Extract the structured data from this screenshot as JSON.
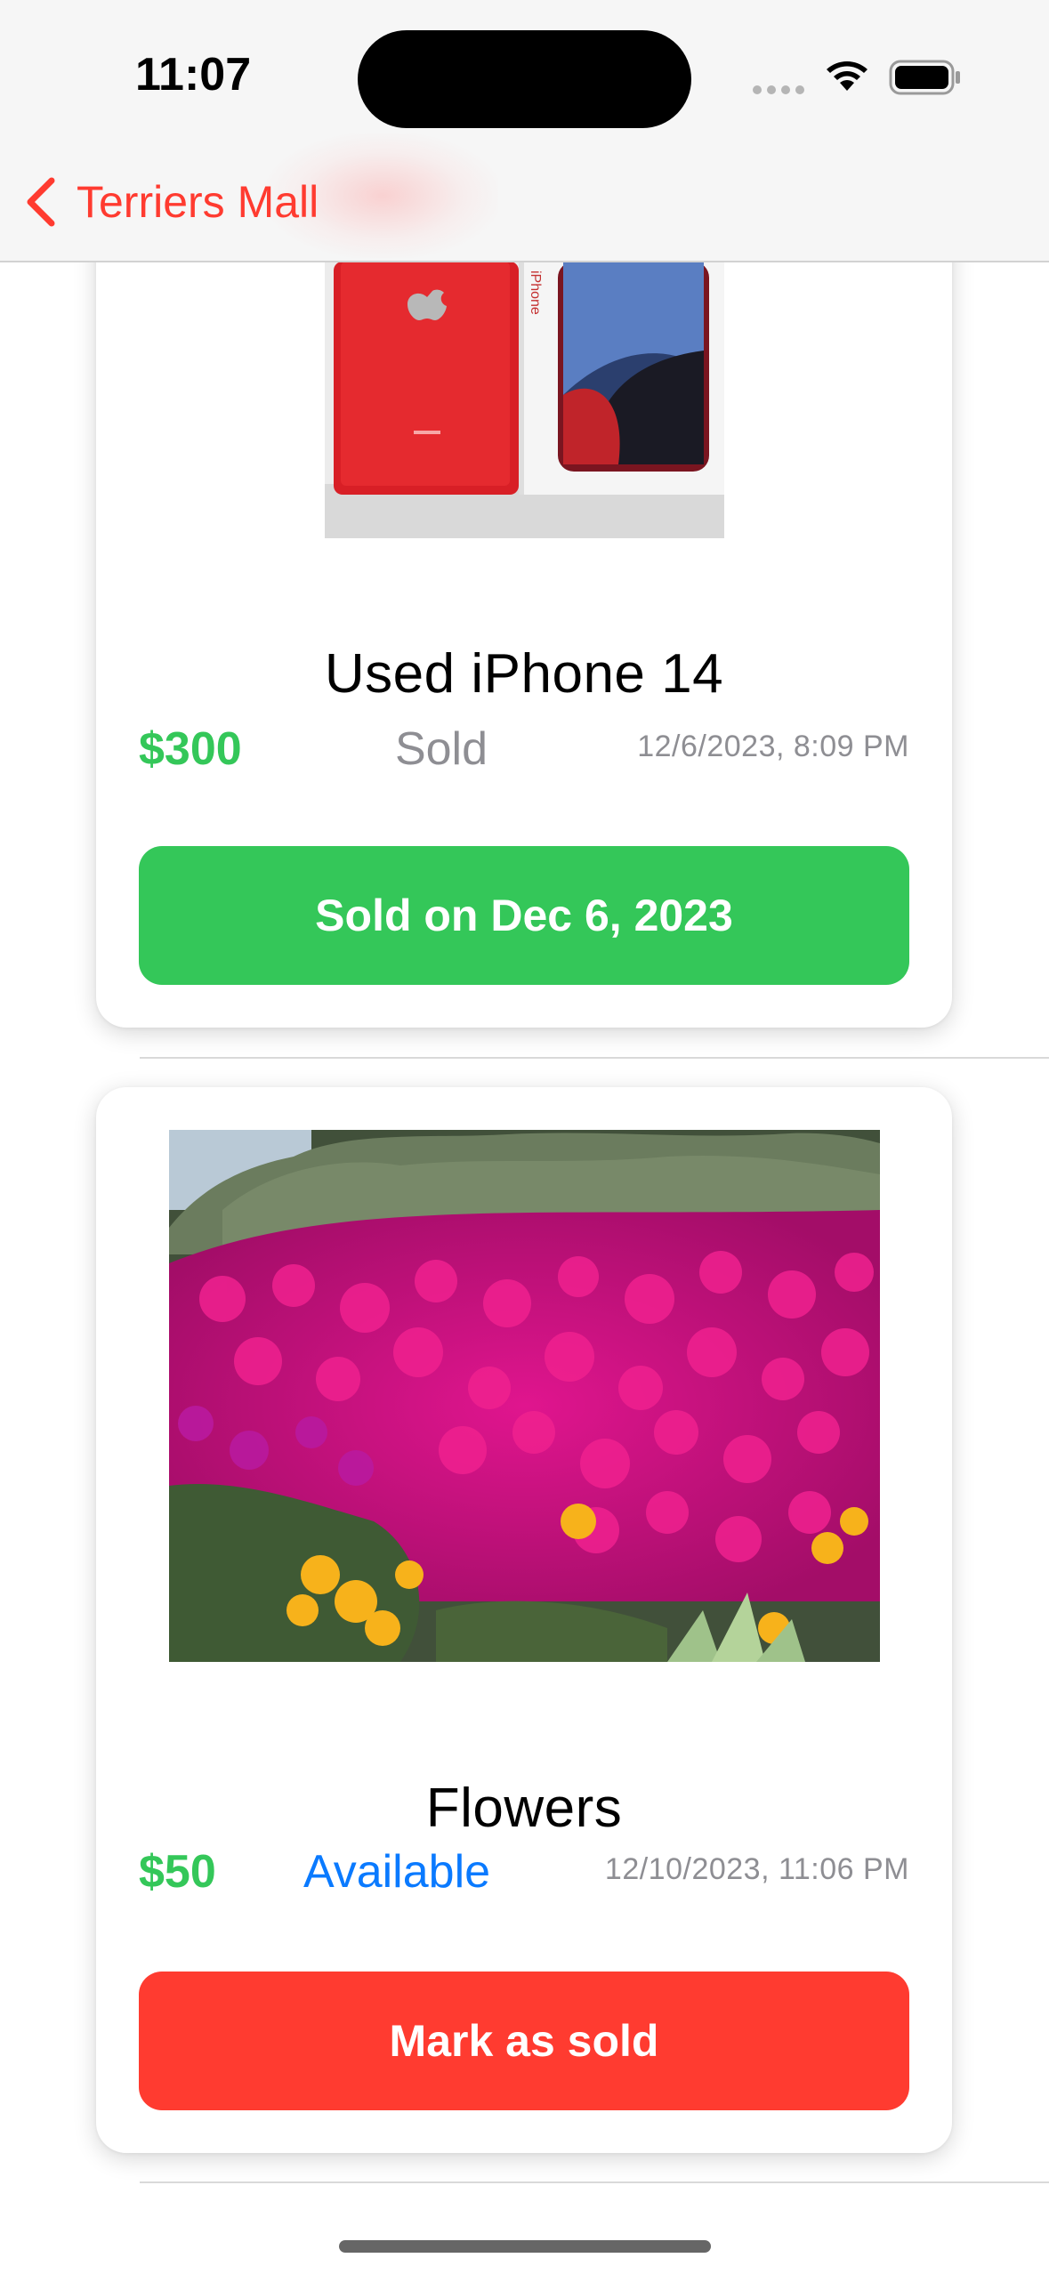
{
  "status_bar": {
    "time": "11:07"
  },
  "nav": {
    "back_label": "Terriers Mall",
    "accent_color": "#ff3b30"
  },
  "items": [
    {
      "name": "Used iPhone 14",
      "price": "$300",
      "status": "Sold",
      "timestamp": "12/6/2023, 8:09 PM",
      "button_label": "Sold on Dec 6, 2023",
      "button_color": "#34c759",
      "image": "iphone-box-photo"
    },
    {
      "name": "Flowers",
      "price": "$50",
      "status": "Available",
      "timestamp": "12/10/2023, 11:06 PM",
      "button_label": "Mark as sold",
      "button_color": "#ff3b30",
      "image": "flowers-photo"
    }
  ],
  "colors": {
    "price": "#34c759",
    "status_sold": "#8e8e93",
    "status_available": "#0a7aff"
  }
}
